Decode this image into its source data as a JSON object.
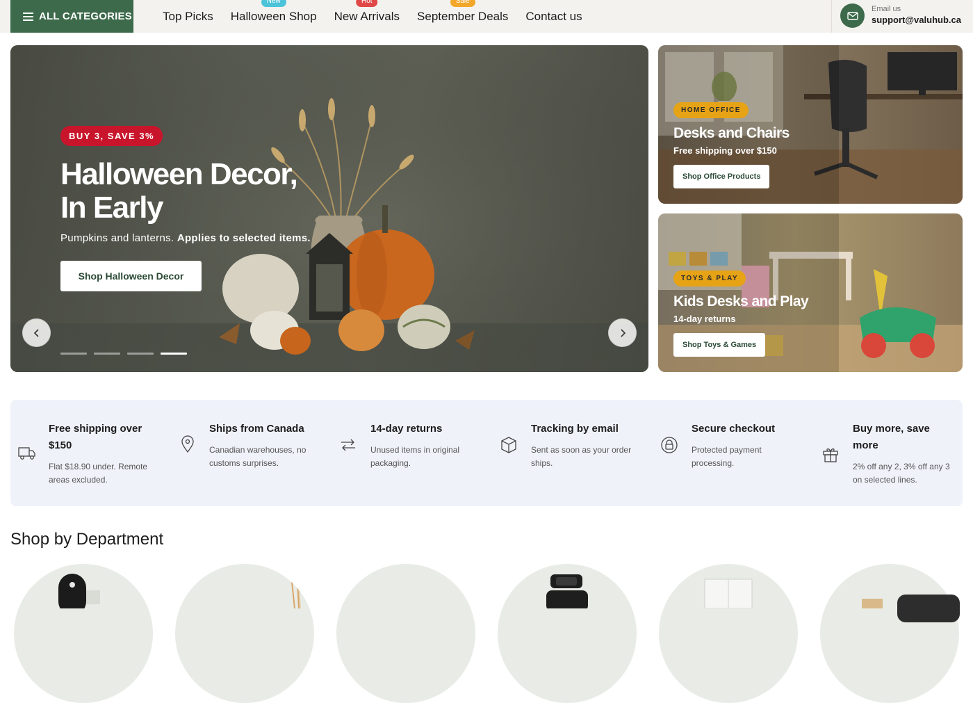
{
  "nav": {
    "all_categories": "ALL CATEGORIES",
    "links": [
      {
        "label": "Top Picks",
        "badge": "",
        "badge_color": ""
      },
      {
        "label": "Halloween Shop",
        "badge": "New",
        "badge_color": "#4cc3d9"
      },
      {
        "label": "New Arrivals",
        "badge": "Hot",
        "badge_color": "#e04848"
      },
      {
        "label": "September Deals",
        "badge": "Sale",
        "badge_color": "#f2a72a"
      },
      {
        "label": "Contact us",
        "badge": "",
        "badge_color": ""
      }
    ],
    "email_label": "Email us",
    "email": "support@valuhub.ca"
  },
  "hero": {
    "promo": "BUY 3, SAVE 3%",
    "title_line1": "Halloween Decor,",
    "title_line2": "In Early",
    "subtitle_plain": "Pumpkins and lanterns.",
    "subtitle_bold": "Applies to selected items.",
    "button": "Shop Halloween Decor",
    "slide_count": 4,
    "active_slide": 4
  },
  "promos": [
    {
      "badge": "HOME OFFICE",
      "title": "Desks and Chairs",
      "subtitle": "Free shipping over $150",
      "button": "Shop Office Products"
    },
    {
      "badge": "TOYS & PLAY",
      "title": "Kids Desks and Play",
      "subtitle": "14-day returns",
      "button": "Shop Toys & Games"
    }
  ],
  "features": [
    {
      "icon": "truck-icon",
      "title": "Free shipping over $150",
      "desc": "Flat $18.90 under. Remote areas excluded."
    },
    {
      "icon": "location-pin-icon",
      "title": "Ships from Canada",
      "desc": "Canadian warehouses, no customs surprises."
    },
    {
      "icon": "return-arrows-icon",
      "title": "14-day returns",
      "desc": "Unused items in original packaging."
    },
    {
      "icon": "box-icon",
      "title": "Tracking by email",
      "desc": "Sent as soon as your order ships."
    },
    {
      "icon": "lock-icon",
      "title": "Secure checkout",
      "desc": "Protected payment processing."
    },
    {
      "icon": "gift-icon",
      "title": "Buy more, save more",
      "desc": "2% off any 2, 3% off any 3 on selected lines."
    }
  ],
  "departments": {
    "title": "Shop by Department"
  },
  "colors": {
    "brand_green": "#3c6a4b",
    "promo_red": "#c8152b",
    "badge_amber": "#e7a316",
    "feature_bg": "#f0f2fa"
  }
}
